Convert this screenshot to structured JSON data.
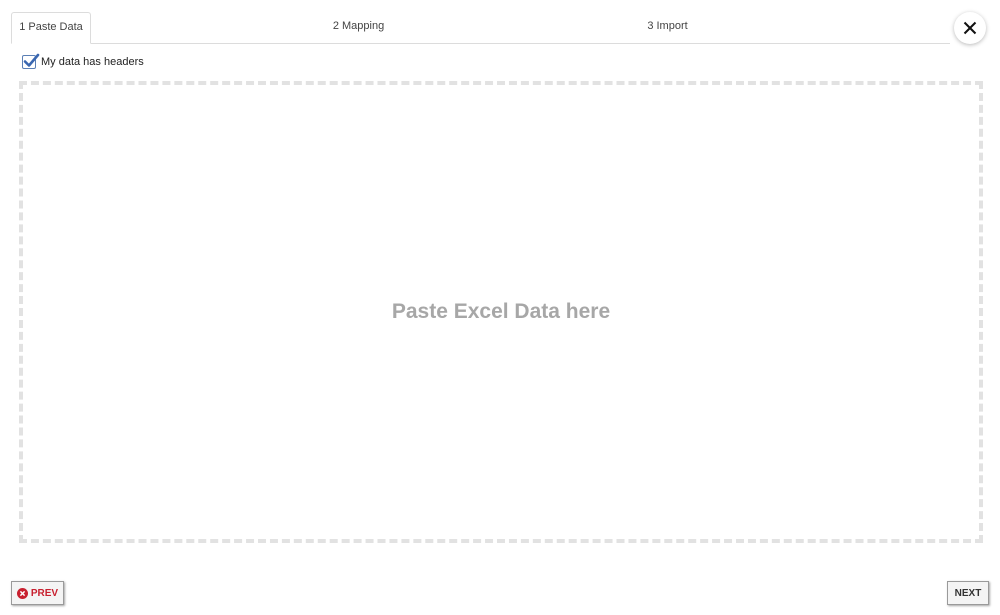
{
  "tabs": [
    {
      "label": "1 Paste Data",
      "active": true
    },
    {
      "label": "2 Mapping",
      "active": false
    },
    {
      "label": "3 Import",
      "active": false
    }
  ],
  "close": {
    "icon": "close-icon"
  },
  "headers_option": {
    "label": "My data has headers",
    "checked": true
  },
  "dropzone": {
    "text": "Paste Excel Data here"
  },
  "footer": {
    "prev_label": "PREV",
    "prev_icon": "cancel-circle-icon",
    "next_label": "NEXT"
  },
  "colors": {
    "accent_check": "#3a67b0",
    "prev_red": "#c8202f",
    "drop_text": "#a7a7a7",
    "drop_border": "#e2e2e2"
  }
}
